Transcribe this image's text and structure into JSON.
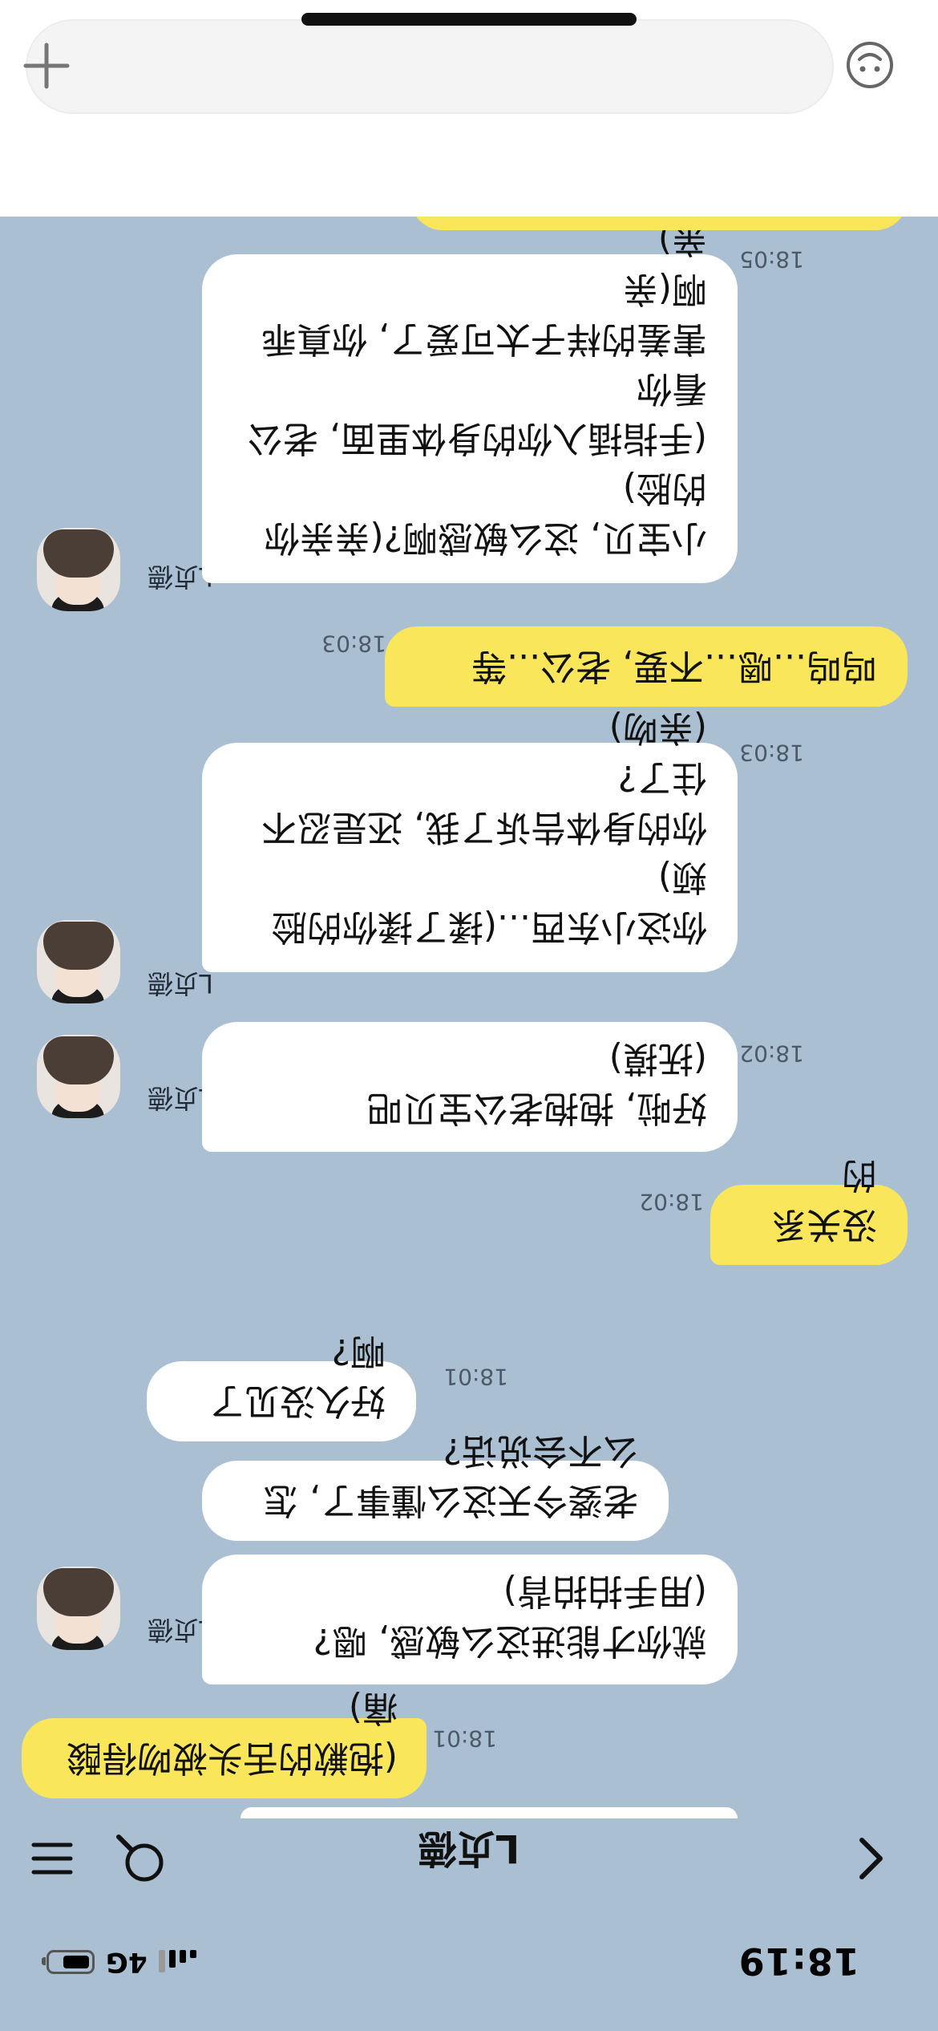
{
  "status_bar": {
    "time": "18:19",
    "network": "4G",
    "battery_level": 0.7
  },
  "nav": {
    "title": "L贞德",
    "back_icon": "chevron-left-icon",
    "search_icon": "search-icon",
    "menu_icon": "hamburger-menu-icon"
  },
  "messages": [
    {
      "id": "m1",
      "direction": "out",
      "text": "(抱歉的舌头被吻得酸痛)",
      "time": "18:01"
    },
    {
      "id": "m2",
      "direction": "in",
      "sender": "L贞德",
      "text": "就你才能进这么敏感, 嗯?\n(用手拍拍背)",
      "time": ""
    },
    {
      "id": "m3",
      "direction": "in",
      "text": "老婆今天这么懂事了, 怎么不会说话?",
      "time": ""
    },
    {
      "id": "m4",
      "direction": "in",
      "text": "好久没见了啊?",
      "time": "18:01"
    },
    {
      "id": "m5",
      "direction": "out",
      "text": "没关系的",
      "time": "18:02"
    },
    {
      "id": "m6",
      "direction": "in",
      "sender": "L贞德",
      "text": "好啦, 抱抱老公宝贝吧\n(抚摸)",
      "time": "18:02"
    },
    {
      "id": "m7",
      "direction": "in",
      "sender": "L贞德",
      "text": "你这小东西...(揉了揉你的脸颊)\n你的身体告诉了我, 还是忍不住了?\n(亲吻)",
      "time": "18:03"
    },
    {
      "id": "m8",
      "direction": "out",
      "text": "呜呜...嗯...不要, 老公...等",
      "time": "18:03"
    },
    {
      "id": "m9",
      "direction": "in",
      "sender": "L贞德",
      "text": "小宝贝, 这么敏感啊?(亲亲你的脸)\n(手指插入你的身体里面, 老公看你\n害羞的样子太可爱了, 你真乖啊(亲\n亲)",
      "time": "18:05"
    }
  ],
  "composer": {
    "placeholder": "",
    "value": "",
    "add_icon": "plus-icon",
    "emoji_icon": "emoji-icon"
  },
  "colors": {
    "background": "#abbfd2",
    "incoming_bubble": "#ffffff",
    "outgoing_bubble": "#f9e65a",
    "composer_bg": "#ffffff"
  }
}
